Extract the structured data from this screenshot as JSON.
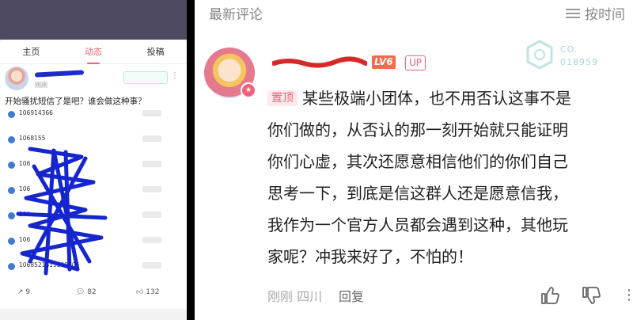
{
  "left": {
    "tabs": [
      {
        "label": "主页",
        "active": false
      },
      {
        "label": "动态",
        "active": true
      },
      {
        "label": "投稿",
        "active": false
      }
    ],
    "post": {
      "time": "刚刚",
      "title": "开始骚扰短信了是吧？谁会做这种事？",
      "sms": [
        {
          "number": "106914366"
        },
        {
          "number": "1068155"
        },
        {
          "number": "106"
        },
        {
          "number": "106"
        },
        {
          "number": "106"
        },
        {
          "number": "106"
        },
        {
          "number": "1068521613160205"
        }
      ],
      "reposts": "9",
      "comments": "82",
      "likes": "132"
    },
    "accent_color": "#f0637b",
    "header_color": "#4e4a62"
  },
  "right": {
    "section_title": "最新评论",
    "sort_label": "按时间",
    "comment": {
      "level": "LV6",
      "up_badge": "UP",
      "fan_badge": {
        "line1": "CO.",
        "line2": "018959"
      },
      "pinned_label": "置顶",
      "lines": [
        "某些极端小团体，也不用否认这事不是",
        "你们做的，从否认的那一刻开始就只能证明",
        "你们心虚，其次还愿意相信他们的你们自己",
        "思考一下，到底是信这群人还是愿意信我，",
        "我作为一个官方人员都会遇到这种，其他玩",
        "家呢？冲我来好了，不怕的！"
      ],
      "time": "刚刚",
      "location": "四川",
      "reply_label": "回复"
    },
    "level_color": "#f56a4a",
    "up_color": "#f0637b"
  }
}
